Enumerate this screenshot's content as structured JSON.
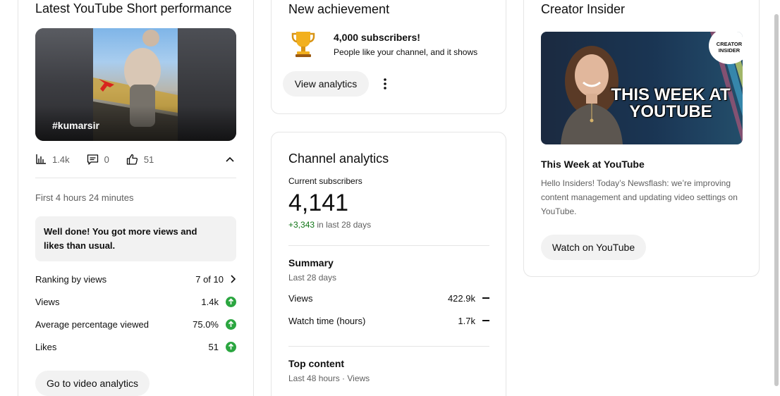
{
  "short_card": {
    "title": "Latest YouTube Short performance",
    "thumb_text": "#kumarsir",
    "stats": {
      "views": "1.4k",
      "comments": "0",
      "likes": "51"
    },
    "period": "First 4 hours 24 minutes",
    "message": "Well done! You got more views and likes than usual.",
    "metrics": [
      {
        "label": "Ranking by views",
        "value": "7 of 10"
      },
      {
        "label": "Views",
        "value": "1.4k"
      },
      {
        "label": "Average percentage viewed",
        "value": "75.0%"
      },
      {
        "label": "Likes",
        "value": "51"
      }
    ],
    "button": "Go to video analytics"
  },
  "achievement": {
    "title": "New achievement",
    "heading": "4,000 subscribers!",
    "subtext": "People like your channel, and it shows",
    "button": "View analytics"
  },
  "analytics": {
    "title": "Channel analytics",
    "current_label": "Current subscribers",
    "subscribers": "4,141",
    "change": "+3,343",
    "change_suffix": "in last 28 days",
    "summary_title": "Summary",
    "summary_period": "Last 28 days",
    "rows": [
      {
        "label": "Views",
        "value": "422.9k"
      },
      {
        "label": "Watch time (hours)",
        "value": "1.7k"
      }
    ],
    "top_title": "Top content",
    "top_period": "Last 48 hours · Views"
  },
  "insider": {
    "title": "Creator Insider",
    "logo_line1": "CREATOR",
    "logo_line2": "INSIDER",
    "thumb_line1": "THIS WEEK AT",
    "thumb_line2": "YOUTUBE",
    "video_title": "This Week at YouTube",
    "description": "Hello Insiders! Today’s Newsflash: we’re improving content management and updating video settings on YouTube.",
    "button": "Watch on YouTube"
  },
  "colors": {
    "accent_green": "#2ba640",
    "positive_text": "#107516"
  }
}
